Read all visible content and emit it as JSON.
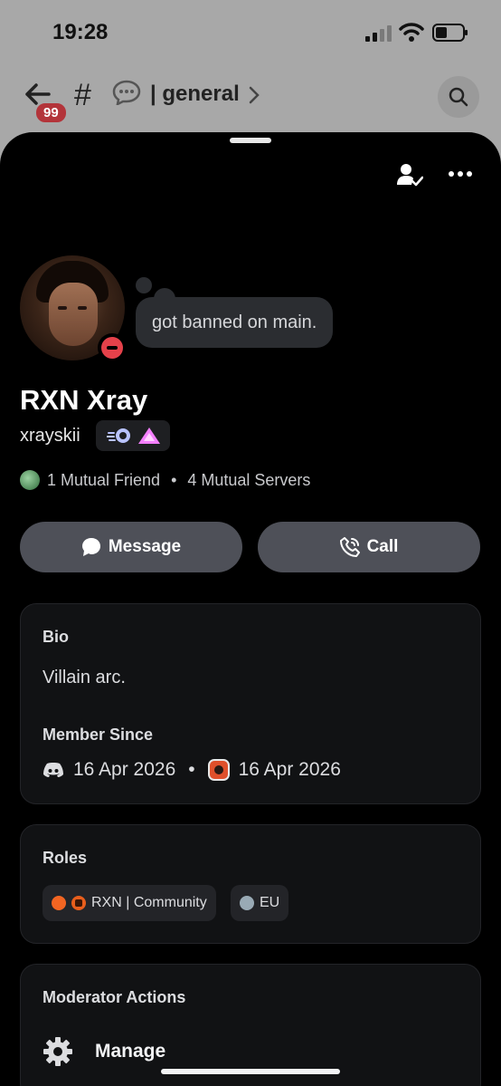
{
  "status_bar": {
    "time": "19:28"
  },
  "channel_header": {
    "unread_badge": "99",
    "hash": "#",
    "channel_name": "general"
  },
  "profile": {
    "custom_status": "got banned on main.",
    "display_name": "RXN Xray",
    "username": "xrayskii",
    "mutual_friends": "1 Mutual Friend",
    "separator": "•",
    "mutual_servers": "4 Mutual Servers"
  },
  "actions": {
    "message_label": "Message",
    "call_label": "Call"
  },
  "bio_card": {
    "bio_title": "Bio",
    "bio_text": "Villain arc.",
    "member_since_title": "Member Since",
    "discord_date": "16 Apr 2026",
    "separator": "•",
    "server_date": "16 Apr 2026"
  },
  "roles_card": {
    "title": "Roles",
    "roles": [
      {
        "name": "RXN | Community",
        "color": "#f26522"
      },
      {
        "name": "EU",
        "color": "#99aab5"
      }
    ]
  },
  "moderator_card": {
    "title": "Moderator Actions",
    "manage_label": "Manage"
  },
  "icons": {
    "back": "back-arrow-icon",
    "thread": "chat-bubble-icon",
    "search": "search-icon",
    "friend_status": "friend-check-icon",
    "more": "more-horizontal-icon",
    "message": "message-bubble-icon",
    "call": "phone-icon",
    "discord": "discord-logo-icon",
    "manage": "gear-icon"
  }
}
